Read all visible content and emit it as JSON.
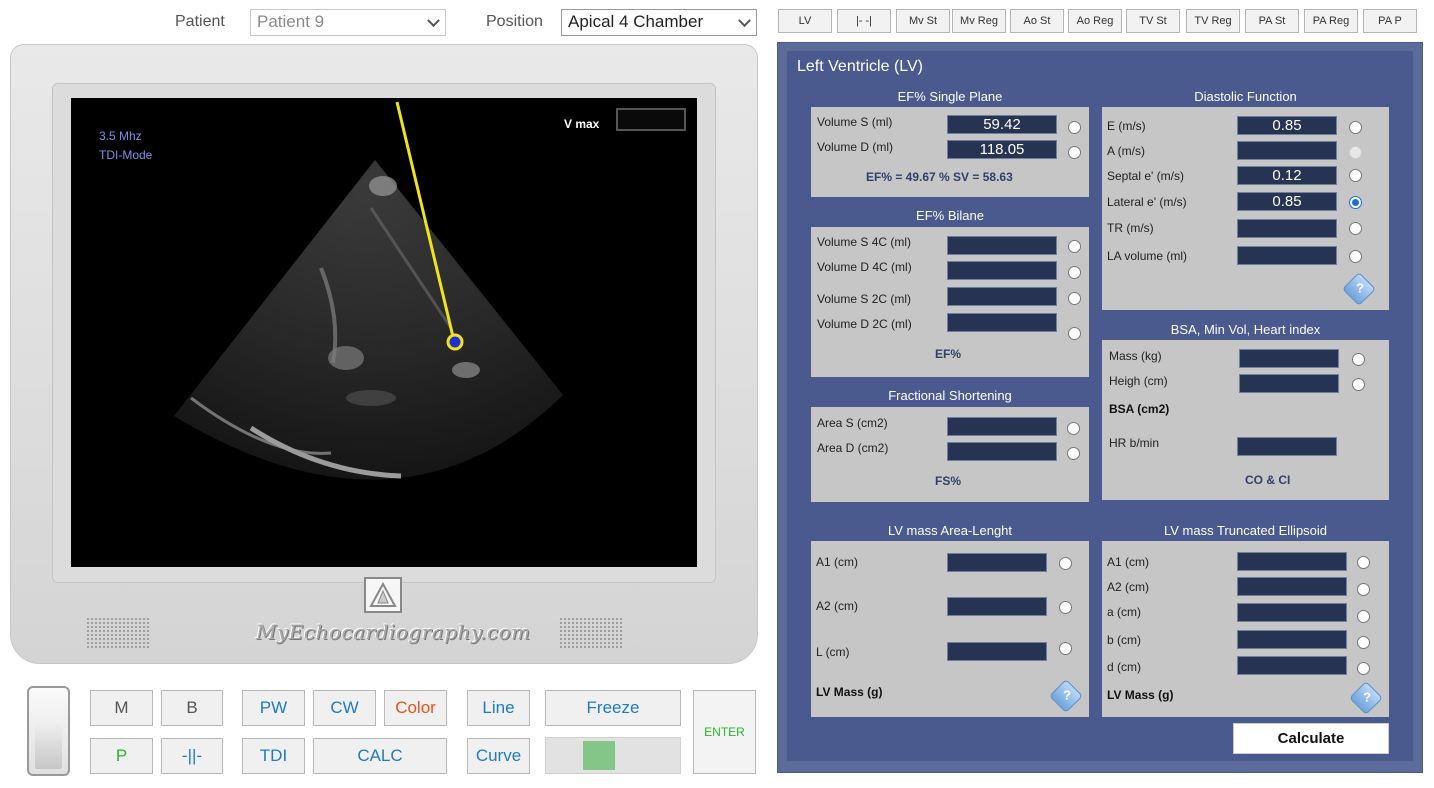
{
  "top": {
    "patient_label": "Patient",
    "patient_value": "Patient 9",
    "position_label": "Position",
    "position_value": "Apical 4 Chamber"
  },
  "tabs": [
    "LV",
    "|- -|",
    "Mv St",
    "Mv Reg",
    "Ao St",
    "Ao Reg",
    "TV St",
    "TV Reg",
    "PA St",
    "PA Reg",
    "PA P"
  ],
  "screen": {
    "freq": "3.5 Mhz",
    "mode": "TDI-Mode",
    "vmax_label": "V max",
    "brand": "MyEchocardiography.com"
  },
  "controls": {
    "m": "M",
    "b": "B",
    "pw": "PW",
    "cw": "CW",
    "color": "Color",
    "line": "Line",
    "freeze": "Freeze",
    "p": "P",
    "sep": "-||-",
    "tdi": "TDI",
    "calc": "CALC",
    "curve": "Curve",
    "enter": "ENTER",
    "slider_level": 0.35
  },
  "panel": {
    "title": "Left Ventricle (LV)",
    "ef_single": {
      "title": "EF% Single Plane",
      "vol_s_label": "Volume S (ml)",
      "vol_s": "59.42",
      "vol_d_label": "Volume D (ml)",
      "vol_d": "118.05",
      "result": "EF% = 49.67 % SV = 58.63"
    },
    "ef_bilane": {
      "title": "EF% Bilane",
      "s4c": "Volume S 4C (ml)",
      "d4c": "Volume D 4C (ml)",
      "s2c": "Volume S 2C (ml)",
      "d2c": "Volume D 2C (ml)",
      "result": "EF%"
    },
    "fs": {
      "title": "Fractional Shortening",
      "area_s": "Area S (cm2)",
      "area_d": "Area D (cm2)",
      "result": "FS%"
    },
    "diastolic": {
      "title": "Diastolic Function",
      "e_label": "E (m/s)",
      "e": "0.85",
      "a_label": "A (m/s)",
      "a": "",
      "septal_label": "Septal e' (m/s)",
      "septal": "0.12",
      "lateral_label": "Lateral e' (m/s)",
      "lateral": "0.85",
      "tr_label": "TR (m/s)",
      "tr": "",
      "la_label": "LA volume (ml)",
      "la": ""
    },
    "bsa": {
      "title": "BSA, Min Vol, Heart index",
      "mass": "Mass (kg)",
      "height": "Heigh (cm)",
      "bsa_result": "BSA (cm2)",
      "hr": "HR b/min",
      "co_result": "CO & CI"
    },
    "mass_al": {
      "title": "LV mass Area-Lenght",
      "a1": "A1 (cm)",
      "a2": "A2 (cm)",
      "l": "L (cm)",
      "result": "LV Mass (g)"
    },
    "mass_te": {
      "title": "LV mass Truncated Ellipsoid",
      "a1": "A1 (cm)",
      "a2": "A2 (cm)",
      "a": "a (cm)",
      "b": "b (cm)",
      "d": "d (cm)",
      "result": "LV Mass (g)"
    },
    "calculate": "Calculate",
    "help_glyph": "?"
  }
}
